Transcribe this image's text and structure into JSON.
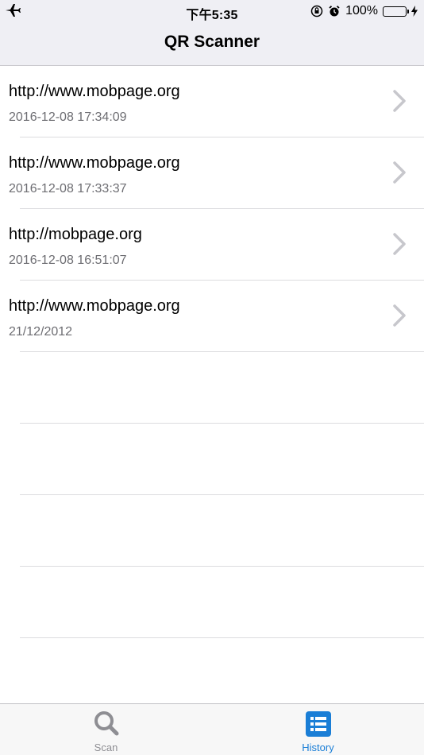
{
  "status_bar": {
    "time": "下午5:35",
    "battery_percent": "100%",
    "icons": [
      "airplane-icon",
      "rotation-lock-icon",
      "alarm-icon",
      "battery-icon",
      "charging-bolt-icon"
    ]
  },
  "nav": {
    "title": "QR Scanner"
  },
  "history": [
    {
      "url": "http://www.mobpage.org",
      "date": "2016-12-08 17:34:09"
    },
    {
      "url": "http://www.mobpage.org",
      "date": "2016-12-08 17:33:37"
    },
    {
      "url": "http://mobpage.org",
      "date": "2016-12-08 16:51:07"
    },
    {
      "url": "http://www.mobpage.org",
      "date": "21/12/2012"
    }
  ],
  "tabs": [
    {
      "label": "Scan",
      "icon": "magnifier-icon",
      "selected": false
    },
    {
      "label": "History",
      "icon": "list-icon",
      "selected": true
    }
  ],
  "colors": {
    "accent": "#1a7ed6",
    "inactive_tab": "#8e8e93",
    "battery_fill": "#4cd964",
    "bar_background": "#efeff4",
    "secondary_text": "#6d6d72"
  }
}
